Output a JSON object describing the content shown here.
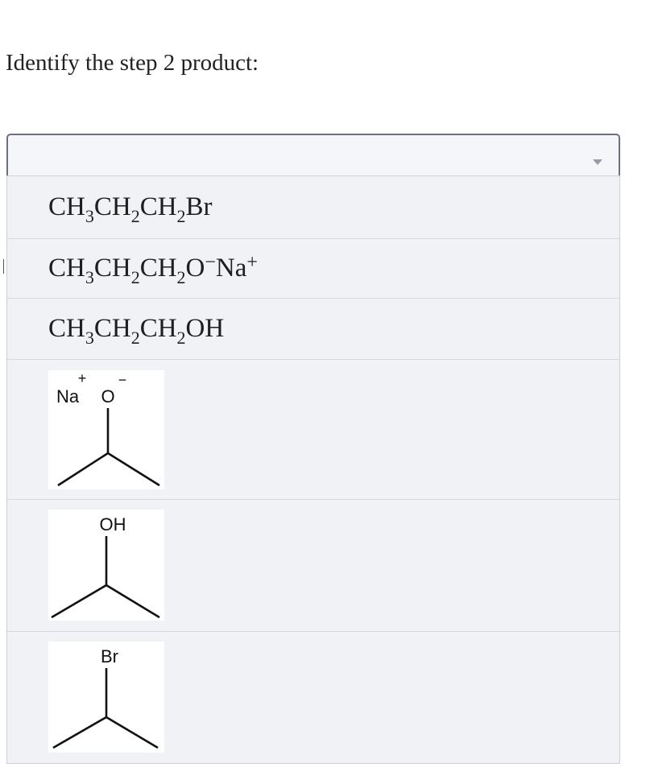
{
  "question": "Identify the step 2 product:",
  "dropdown": {
    "selected": "",
    "caret_icon": "caret-down-icon"
  },
  "options": [
    {
      "type": "formula",
      "parts": [
        [
          "CH",
          "3"
        ],
        [
          "CH",
          "2"
        ],
        [
          "CH",
          "2"
        ],
        [
          "Br",
          ""
        ]
      ]
    },
    {
      "type": "formula",
      "parts": [
        [
          "CH",
          "3"
        ],
        [
          "CH",
          "2"
        ],
        [
          "CH",
          "2"
        ],
        [
          "O",
          ""
        ]
      ],
      "charge1": "−",
      "counterion": "Na",
      "charge2": "+"
    },
    {
      "type": "formula",
      "parts": [
        [
          "CH",
          "3"
        ],
        [
          "CH",
          "2"
        ],
        [
          "CH",
          "2"
        ],
        [
          "OH",
          ""
        ]
      ]
    },
    {
      "type": "structure",
      "labels": [
        "Na",
        "O"
      ],
      "charges": [
        "+",
        "−"
      ]
    },
    {
      "type": "structure",
      "labels": [
        "OH"
      ]
    },
    {
      "type": "structure",
      "labels": [
        "Br"
      ]
    }
  ]
}
